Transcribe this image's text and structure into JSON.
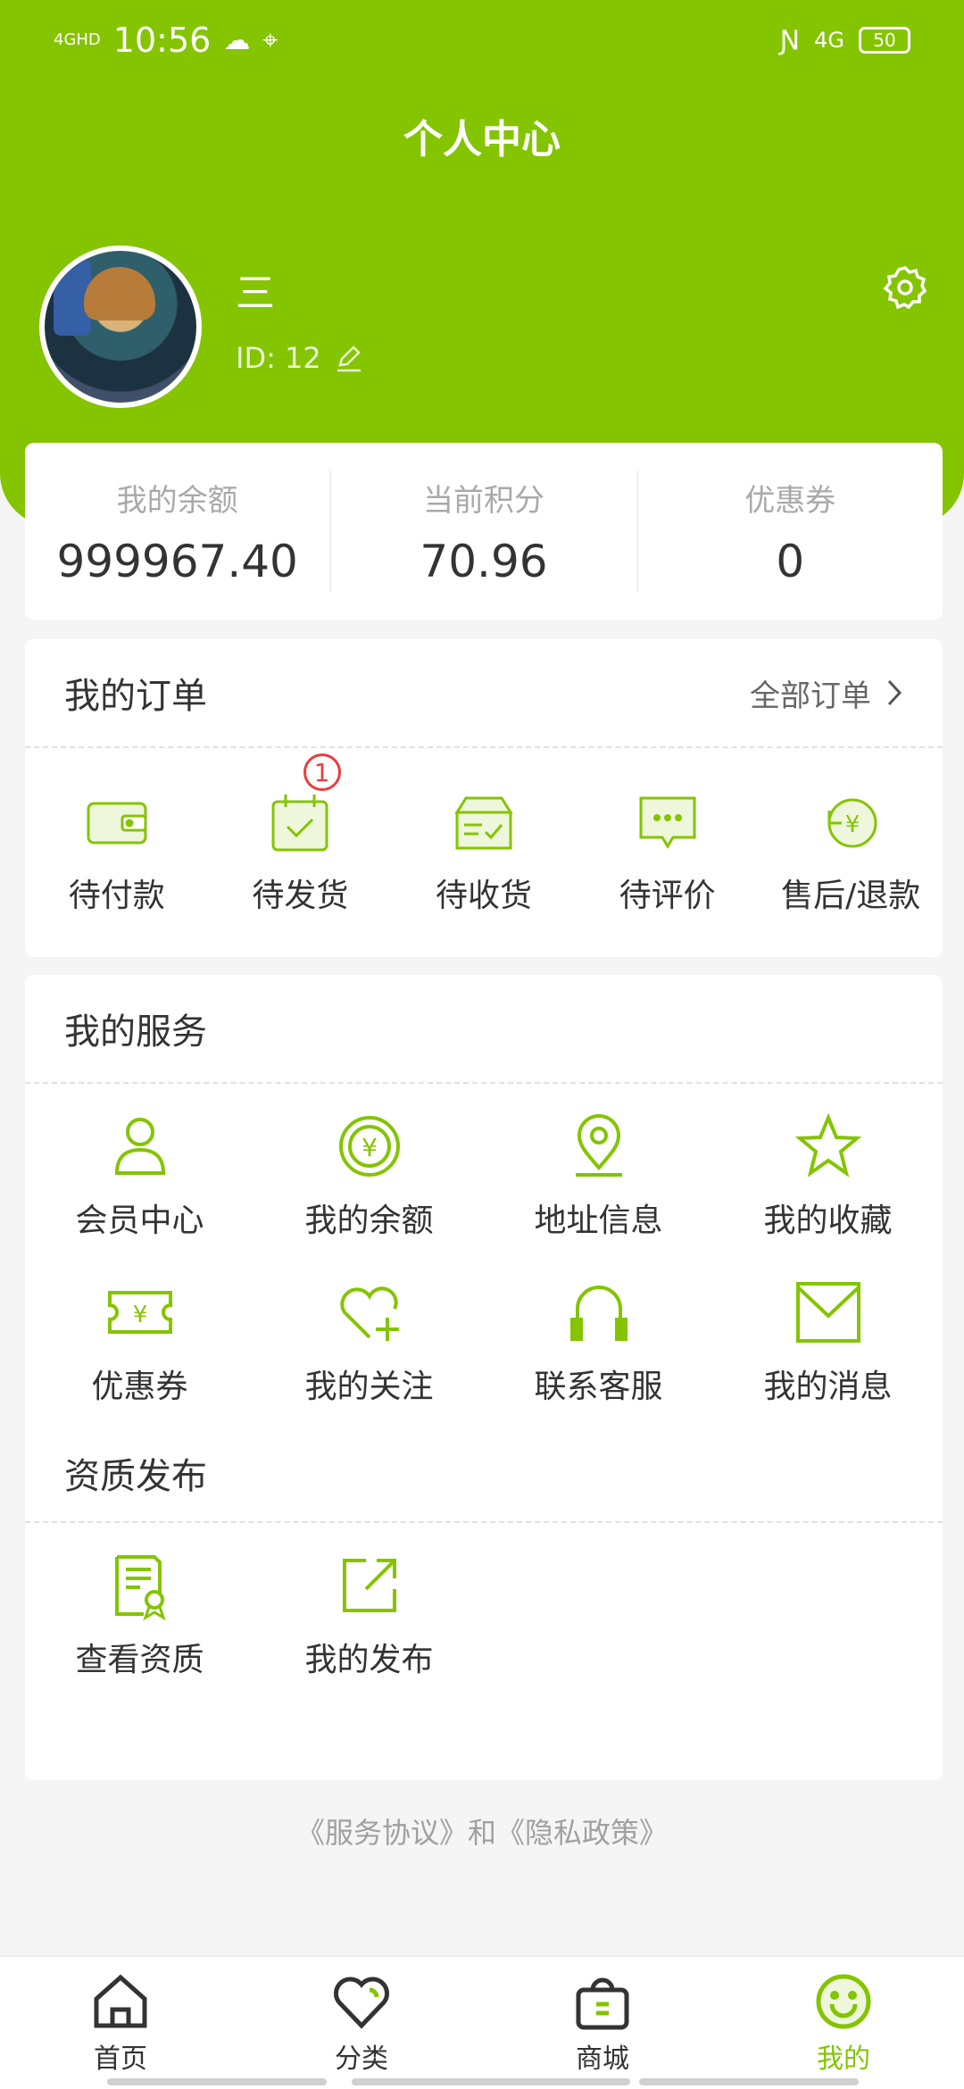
{
  "status_bar": {
    "signal": "4GHD",
    "time": "10:56",
    "network": "4G",
    "battery": "50"
  },
  "header": {
    "title": "个人中心"
  },
  "user": {
    "name": "三",
    "id_label": "ID:",
    "id_value": "12"
  },
  "stats": [
    {
      "label": "我的余额",
      "value": "999967.40"
    },
    {
      "label": "当前积分",
      "value": "70.96"
    },
    {
      "label": "优惠券",
      "value": "0"
    }
  ],
  "orders": {
    "title": "我的订单",
    "more": "全部订单",
    "items": [
      {
        "label": "待付款",
        "icon": "wallet-icon"
      },
      {
        "label": "待发货",
        "icon": "calendar-check-icon",
        "badge": "1"
      },
      {
        "label": "待收货",
        "icon": "box-icon"
      },
      {
        "label": "待评价",
        "icon": "chat-icon"
      },
      {
        "label": "售后/退款",
        "icon": "refund-icon"
      }
    ]
  },
  "services": {
    "title": "我的服务",
    "items": [
      {
        "label": "会员中心",
        "icon": "user-icon"
      },
      {
        "label": "我的余额",
        "icon": "yuan-coin-icon"
      },
      {
        "label": "地址信息",
        "icon": "location-icon"
      },
      {
        "label": "我的收藏",
        "icon": "star-icon"
      },
      {
        "label": "优惠券",
        "icon": "coupon-icon"
      },
      {
        "label": "我的关注",
        "icon": "heart-plus-icon"
      },
      {
        "label": "联系客服",
        "icon": "headset-icon"
      },
      {
        "label": "我的消息",
        "icon": "mail-icon"
      }
    ]
  },
  "qualification": {
    "title": "资质发布",
    "items": [
      {
        "label": "查看资质",
        "icon": "certificate-icon"
      },
      {
        "label": "我的发布",
        "icon": "share-icon"
      }
    ]
  },
  "agreement": "《服务协议》和《隐私政策》",
  "tabbar": [
    {
      "label": "首页",
      "icon": "home-icon"
    },
    {
      "label": "分类",
      "icon": "heart-icon"
    },
    {
      "label": "商城",
      "icon": "bag-icon"
    },
    {
      "label": "我的",
      "icon": "smile-icon",
      "active": true
    }
  ],
  "colors": {
    "accent": "#84c400",
    "badge": "#e83e3e"
  }
}
